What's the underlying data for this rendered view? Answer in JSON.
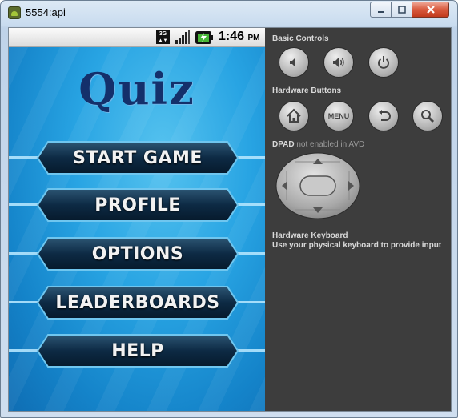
{
  "window": {
    "title": "5554:api",
    "buttons": {
      "minimize": "minimize-icon",
      "maximize": "maximize-icon",
      "close": "close-icon"
    }
  },
  "status_bar": {
    "network": "3G",
    "time": "1:46",
    "ampm": "PM"
  },
  "game": {
    "logo": "Quiz",
    "menu": [
      {
        "label": "START GAME"
      },
      {
        "label": "PROFILE"
      },
      {
        "label": "OPTIONS"
      },
      {
        "label": "LEADERBOARDS"
      },
      {
        "label": "HELP"
      }
    ]
  },
  "controls": {
    "basic_title": "Basic Controls",
    "basic_buttons": [
      "volume-down-icon",
      "volume-up-icon",
      "power-icon"
    ],
    "hardware_title": "Hardware Buttons",
    "hardware_buttons": [
      "home-icon",
      "menu-icon",
      "back-icon",
      "search-icon"
    ],
    "menu_label": "MENU",
    "dpad_title": "DPAD",
    "dpad_note": "not enabled in AVD",
    "keyboard_title": "Hardware Keyboard",
    "keyboard_note": "Use your physical keyboard to provide input"
  },
  "colors": {
    "logo": "#14306b",
    "background": "#1b94d8",
    "panel": "#3d3d3d",
    "button_fill": "#0d2a44",
    "button_border": "#6fc6ef"
  }
}
